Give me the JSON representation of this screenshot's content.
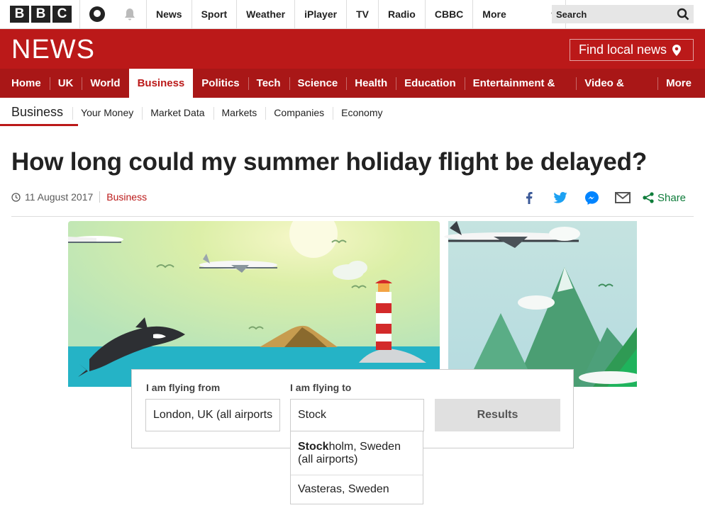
{
  "topbar": {
    "logo_letters": [
      "B",
      "B",
      "C"
    ],
    "nav": [
      "News",
      "Sport",
      "Weather",
      "iPlayer",
      "TV",
      "Radio",
      "CBBC"
    ],
    "more_label": "More",
    "search_placeholder": "Search"
  },
  "header": {
    "title": "NEWS",
    "local_news_label": "Find local news",
    "brand_color": "#bb1919"
  },
  "main_nav": {
    "items": [
      "Home",
      "UK",
      "World",
      "Business",
      "Politics",
      "Tech",
      "Science",
      "Health",
      "Education",
      "Entertainment & Arts",
      "Video & Audio",
      "More"
    ],
    "active": "Business"
  },
  "sub_nav": {
    "section": "Business",
    "items": [
      "Your Money",
      "Market Data",
      "Markets",
      "Companies",
      "Economy"
    ]
  },
  "article": {
    "headline": "How long could my summer holiday flight be delayed?",
    "date": "11 August 2017",
    "section": "Business",
    "share_label": "Share"
  },
  "widget": {
    "from_label": "I am flying from",
    "from_value": "London, UK (all airports",
    "to_label": "I am flying to",
    "to_value": "Stock",
    "results_label": "Results",
    "suggestions": [
      {
        "match": "Stock",
        "rest": "holm, Sweden (all airports)"
      },
      {
        "match": "",
        "rest": "Vasteras, Sweden"
      }
    ]
  }
}
